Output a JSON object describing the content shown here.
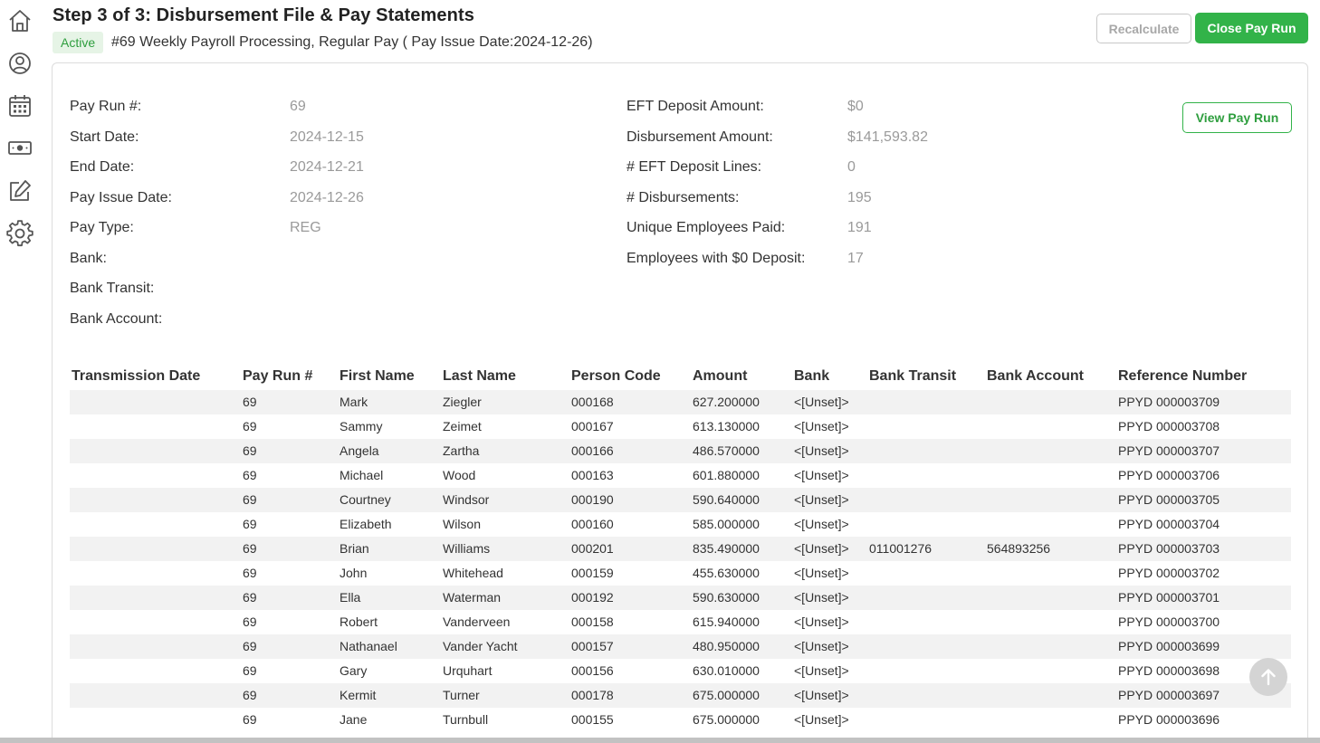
{
  "header": {
    "title": "Step 3 of 3: Disbursement File & Pay Statements",
    "status": "Active",
    "subtitle": "#69 Weekly Payroll Processing, Regular Pay ( Pay Issue Date:2024-12-26)"
  },
  "buttons": {
    "recalculate": "Recalculate",
    "close_pay_run": "Close Pay Run",
    "view_pay_run": "View Pay Run"
  },
  "sidebar": {
    "icons": [
      "home-icon",
      "user-circle-icon",
      "calendar-icon",
      "money-icon",
      "edit-icon",
      "gear-icon"
    ]
  },
  "details_left": [
    {
      "label": "Pay Run #:",
      "value": "69"
    },
    {
      "label": "Start Date:",
      "value": "2024-12-15"
    },
    {
      "label": "End Date:",
      "value": "2024-12-21"
    },
    {
      "label": "Pay Issue Date:",
      "value": "2024-12-26"
    },
    {
      "label": "Pay Type:",
      "value": "REG"
    },
    {
      "label": "Bank:",
      "value": ""
    },
    {
      "label": "Bank Transit:",
      "value": ""
    },
    {
      "label": "Bank Account:",
      "value": ""
    }
  ],
  "details_right": [
    {
      "label": "EFT Deposit Amount:",
      "value": "$0"
    },
    {
      "label": "Disbursement Amount:",
      "value": "$141,593.82"
    },
    {
      "label": "# EFT Deposit Lines:",
      "value": "0"
    },
    {
      "label": "# Disbursements:",
      "value": "195"
    },
    {
      "label": "Unique Employees Paid:",
      "value": "191"
    },
    {
      "label": "Employees with $0 Deposit:",
      "value": "17"
    }
  ],
  "table": {
    "columns": [
      "Transmission Date",
      "Pay Run #",
      "First Name",
      "Last Name",
      "Person Code",
      "Amount",
      "Bank",
      "Bank Transit",
      "Bank Account",
      "Reference Number"
    ],
    "rows": [
      [
        "",
        "69",
        "Mark",
        "Ziegler",
        "000168",
        "627.200000",
        "<[Unset]>",
        "",
        "",
        "PPYD 000003709"
      ],
      [
        "",
        "69",
        "Sammy",
        "Zeimet",
        "000167",
        "613.130000",
        "<[Unset]>",
        "",
        "",
        "PPYD 000003708"
      ],
      [
        "",
        "69",
        "Angela",
        "Zartha",
        "000166",
        "486.570000",
        "<[Unset]>",
        "",
        "",
        "PPYD 000003707"
      ],
      [
        "",
        "69",
        "Michael",
        "Wood",
        "000163",
        "601.880000",
        "<[Unset]>",
        "",
        "",
        "PPYD 000003706"
      ],
      [
        "",
        "69",
        "Courtney",
        "Windsor",
        "000190",
        "590.640000",
        "<[Unset]>",
        "",
        "",
        "PPYD 000003705"
      ],
      [
        "",
        "69",
        "Elizabeth",
        "Wilson",
        "000160",
        "585.000000",
        "<[Unset]>",
        "",
        "",
        "PPYD 000003704"
      ],
      [
        "",
        "69",
        "Brian",
        "Williams",
        "000201",
        "835.490000",
        "<[Unset]>",
        "011001276",
        "564893256",
        "PPYD 000003703"
      ],
      [
        "",
        "69",
        "John",
        "Whitehead",
        "000159",
        "455.630000",
        "<[Unset]>",
        "",
        "",
        "PPYD 000003702"
      ],
      [
        "",
        "69",
        "Ella",
        "Waterman",
        "000192",
        "590.630000",
        "<[Unset]>",
        "",
        "",
        "PPYD 000003701"
      ],
      [
        "",
        "69",
        "Robert",
        "Vanderveen",
        "000158",
        "615.940000",
        "<[Unset]>",
        "",
        "",
        "PPYD 000003700"
      ],
      [
        "",
        "69",
        "Nathanael",
        "Vander Yacht",
        "000157",
        "480.950000",
        "<[Unset]>",
        "",
        "",
        "PPYD 000003699"
      ],
      [
        "",
        "69",
        "Gary",
        "Urquhart",
        "000156",
        "630.010000",
        "<[Unset]>",
        "",
        "",
        "PPYD 000003698"
      ],
      [
        "",
        "69",
        "Kermit",
        "Turner",
        "000178",
        "675.000000",
        "<[Unset]>",
        "",
        "",
        "PPYD 000003697"
      ],
      [
        "",
        "69",
        "Jane",
        "Turnbull",
        "000155",
        "675.000000",
        "<[Unset]>",
        "",
        "",
        "PPYD 000003696"
      ]
    ]
  },
  "colors": {
    "accent_green": "#32b349",
    "badge_bg": "#e6f4e6",
    "row_stripe": "#f2f2f2"
  }
}
